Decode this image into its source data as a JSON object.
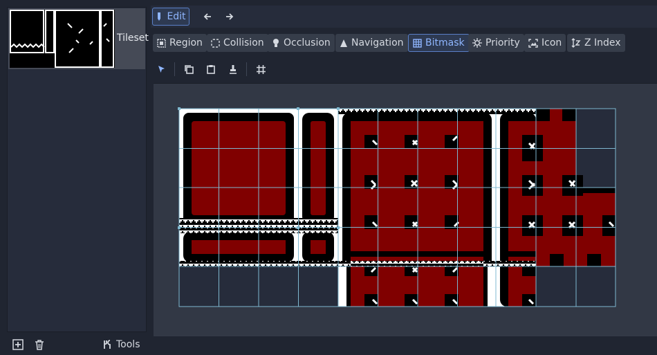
{
  "left_panel": {
    "tileset_name": "Tileset",
    "tools_label": "Tools"
  },
  "top_bar": {
    "edit_label": "Edit"
  },
  "modes": [
    {
      "label": "Region",
      "icon": "region-icon",
      "active": false
    },
    {
      "label": "Collision",
      "icon": "collision-icon",
      "active": false
    },
    {
      "label": "Occlusion",
      "icon": "occlusion-icon",
      "active": false
    },
    {
      "label": "Navigation",
      "icon": "navigation-icon",
      "active": false
    },
    {
      "label": "Bitmask",
      "icon": "bitmask-icon",
      "active": true
    },
    {
      "label": "Priority",
      "icon": "priority-icon",
      "active": false
    },
    {
      "label": "Icon",
      "icon": "icon-mode-icon",
      "active": false
    },
    {
      "label": "Z Index",
      "icon": "z-index-icon",
      "active": false
    }
  ],
  "colors": {
    "accent": "#8fb6ff",
    "tile_fill": "#800000",
    "grid_line": "#7fb8d0",
    "empty_cell": "#262c3b"
  }
}
